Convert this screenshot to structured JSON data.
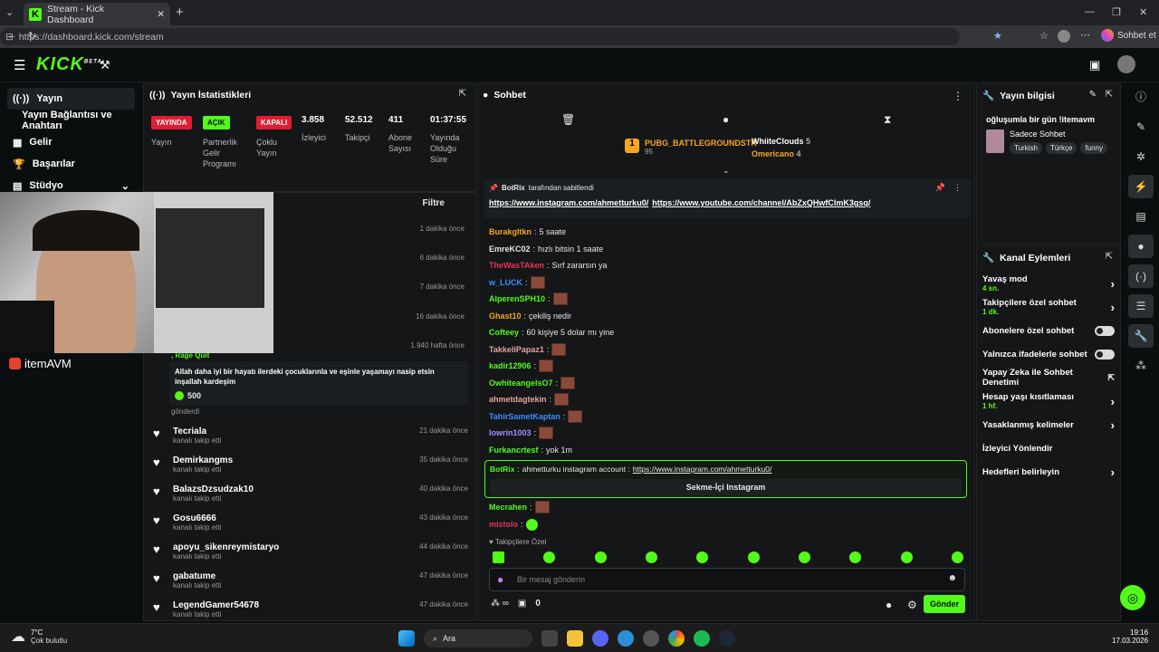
{
  "browser": {
    "tab_title": "Stream - Kick Dashboard",
    "url": "https://dashboard.kick.com/stream",
    "copilot_label": "Sohbet et"
  },
  "logo": {
    "text": "KICK",
    "beta": "BETA"
  },
  "nav": {
    "items": [
      {
        "label": "Yayın"
      },
      {
        "label": "Yayın Bağlantısı ve Anahtarı"
      },
      {
        "label": "Gelir"
      },
      {
        "label": "Başarılar"
      },
      {
        "label": "Stüdyo"
      }
    ]
  },
  "stats": {
    "title": "Yayın İstatistikleri",
    "badges": [
      {
        "text": "YAYINDA",
        "label": "Yayın",
        "color": "#e11d2f"
      },
      {
        "text": "AÇIK",
        "label": "Partnerlik Gelir Programı",
        "color": "#53fc18"
      },
      {
        "text": "KAPALI",
        "label": "Çoklu Yayın",
        "color": "#e11d2f"
      }
    ],
    "numbers": [
      {
        "value": "3.858",
        "label": "İzleyici"
      },
      {
        "value": "52.512",
        "label": "Takipçi"
      },
      {
        "value": "411",
        "label": "Abone Sayısı"
      },
      {
        "value": "01:37:55",
        "label": "Yayında Olduğu Süre"
      }
    ]
  },
  "events": {
    "filter_label": "Filtre",
    "top_times": [
      "1 dakika önce",
      "6 dakika önce",
      "7 dakika önce",
      "16 dakika önce",
      "1.940 hafta önce"
    ],
    "rage_label": ", Rage Quit",
    "gift_message": "Allah daha iyi bir hayatı ilerdeki çocuklarınla ve eşinle yaşamayı nasip etsin inşallah kardeşim",
    "gift_amount": "500",
    "gift_sent": "gönderdi",
    "followers": [
      {
        "name": "Tecriala",
        "sub": "kanalı takip etti",
        "time": "21 dakika önce"
      },
      {
        "name": "Demirkangms",
        "sub": "kanalı takip etti",
        "time": "35 dakika önce"
      },
      {
        "name": "BalazsDzsudzak10",
        "sub": "kanalı takip etti",
        "time": "40 dakika önce"
      },
      {
        "name": "Gosu6666",
        "sub": "kanalı takip etti",
        "time": "43 dakika önce"
      },
      {
        "name": "apoyu_sikenreymistaryo",
        "sub": "kanalı takip etti",
        "time": "44 dakika önce"
      },
      {
        "name": "gabatume",
        "sub": "kanalı takip etti",
        "time": "47 dakika önce"
      },
      {
        "name": "LegendGamer54678",
        "sub": "kanalı takip etti",
        "time": "47 dakika önce"
      }
    ]
  },
  "webcam": {
    "sponsor": "itemAVM"
  },
  "chat": {
    "title": "Sohbet",
    "leaders": [
      {
        "rank": "1",
        "name": "PUBG_BATTLEGROUNDSTR",
        "score": "95"
      },
      {
        "name": "WhiiteClouds",
        "score": "5"
      },
      {
        "name": "Omericano",
        "score": "4"
      }
    ],
    "pinned": {
      "by": "BotRix",
      "by_suffix": "tarafından sabitlendi",
      "link1": "https://www.instagram.com/ahmetturku0/",
      "link2": "https://www.youtube.com/channel/AbZxQHwfClmK3gsq/"
    },
    "messages": [
      {
        "user": "Burakgltkn",
        "text": "5 saate",
        "color": "#f5a623"
      },
      {
        "user": "EmreKC02",
        "text": "hızlı bitsin 1 saate",
        "color": "#e6e6e6"
      },
      {
        "user": "TheWasTAken",
        "text": "Sırf zararsın ya",
        "color": "#e8335a"
      },
      {
        "user": "w_LUCK",
        "text": "",
        "color": "#3c8dff"
      },
      {
        "user": "AlperenSPH10",
        "text": "",
        "color": "#53fc18"
      },
      {
        "user": "Ghast10",
        "text": "çekiliş nedir",
        "color": "#f5a623"
      },
      {
        "user": "Cofteey",
        "text": "60 kişiye 5 dolar mı yine",
        "color": "#53fc18"
      },
      {
        "user": "TakkeliPapaz1",
        "text": "",
        "color": "#e8a0a0"
      },
      {
        "user": "kadir12906",
        "text": "",
        "color": "#53fc18"
      },
      {
        "user": "OwhiteangelsO7",
        "text": "",
        "color": "#53fc18"
      },
      {
        "user": "ahmetdagtekin",
        "text": "",
        "color": "#e8a0a0"
      },
      {
        "user": "TahirSametKaptan",
        "text": "",
        "color": "#3c8dff"
      },
      {
        "user": "lowrin1003",
        "text": "",
        "color": "#a78bfa"
      },
      {
        "user": "Furkancrtesf",
        "text": "yok 1m",
        "color": "#53fc18"
      }
    ],
    "bot_message": {
      "user": "BotRix",
      "text": "ahmetturku instagram account :",
      "link": "https://www.instagram.com/ahmetturku0/",
      "button": "Sekme-İçi Instagram"
    },
    "after": [
      {
        "user": "Mecrahen",
        "color": "#53fc18"
      },
      {
        "user": "mistolo",
        "color": "#e8335a"
      }
    ],
    "followers_only": "Takipçilere Özel",
    "input_placeholder": "Bir mesaj gönderin",
    "points": "0",
    "send_label": "Gönder"
  },
  "stream_info": {
    "title": "Yayın bilgisi",
    "stream_title": "oğluşumla bir gün !itemavm",
    "category": "Sadece Sohbet",
    "tags": [
      "Turkish",
      "Türkçe",
      "funny"
    ]
  },
  "actions": {
    "title": "Kanal Eylemleri",
    "items": [
      {
        "label": "Yavaş mod",
        "sub": "4 sn.",
        "control": "chevron"
      },
      {
        "label": "Takipçilere özel sohbet",
        "sub": "1 dk.",
        "control": "chevron"
      },
      {
        "label": "Abonelere özel sohbet",
        "sub": "",
        "control": "toggle"
      },
      {
        "label": "Yalnızca ifadelerle sohbet",
        "sub": "",
        "control": "toggle"
      },
      {
        "label": "Yapay Zeka ile Sohbet Denetimi",
        "sub": "",
        "control": "external"
      },
      {
        "label": "Hesap yaşı kısıtlaması",
        "sub": "1 hf.",
        "control": "chevron"
      },
      {
        "label": "Yasaklanmış kelimeler",
        "sub": "",
        "control": "chevron"
      },
      {
        "label": "İzleyici Yönlendir",
        "sub": "",
        "control": "none"
      },
      {
        "label": "Hedefleri belirleyin",
        "sub": "",
        "control": "chevron"
      }
    ]
  },
  "taskbar": {
    "weather_temp": "7°C",
    "weather_desc": "Çok bulutlu",
    "search": "Ara",
    "time": "19:16",
    "date": "17.03.2026"
  }
}
